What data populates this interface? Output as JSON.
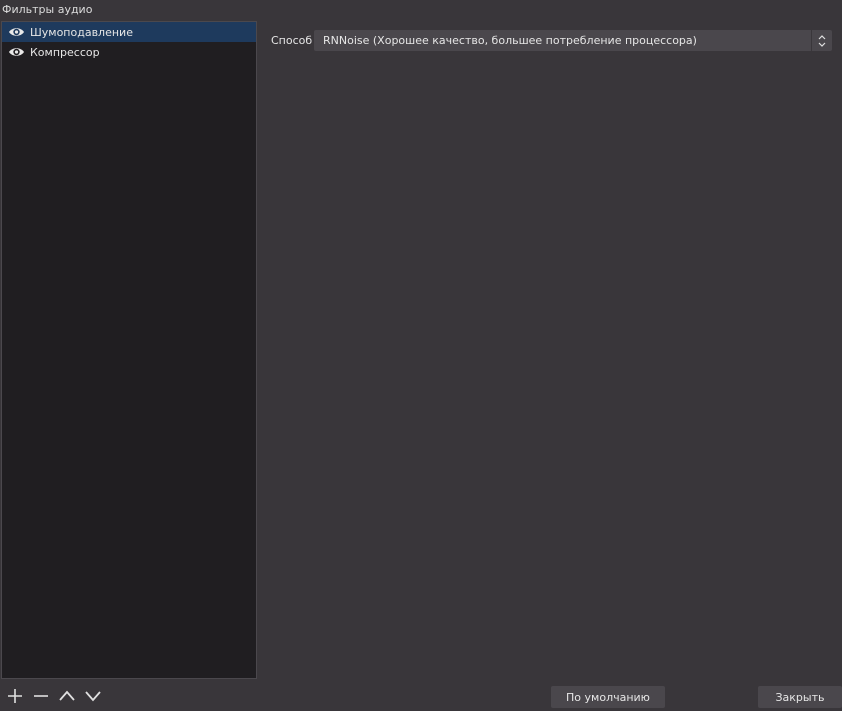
{
  "window": {
    "group_title": "Фильтры аудио"
  },
  "filters": {
    "items": [
      {
        "label": "Шумоподавление",
        "selected": true,
        "icon": "eye-icon"
      },
      {
        "label": "Компрессор",
        "selected": false,
        "icon": "eye-icon"
      }
    ],
    "toolbar": {
      "add_icon": "plus-icon",
      "remove_icon": "minus-icon",
      "up_icon": "chevron-up-icon",
      "down_icon": "chevron-down-icon"
    }
  },
  "properties": {
    "method_label": "Способ",
    "method_value": "RNNoise (Хорошее качество, большее потребление процессора)"
  },
  "buttons": {
    "defaults_label": "По умолчанию",
    "close_label": "Закрыть"
  },
  "colors": {
    "background": "#39363a",
    "list_background": "#201e21",
    "selection": "#1e3a5d",
    "control": "#4a474c"
  }
}
